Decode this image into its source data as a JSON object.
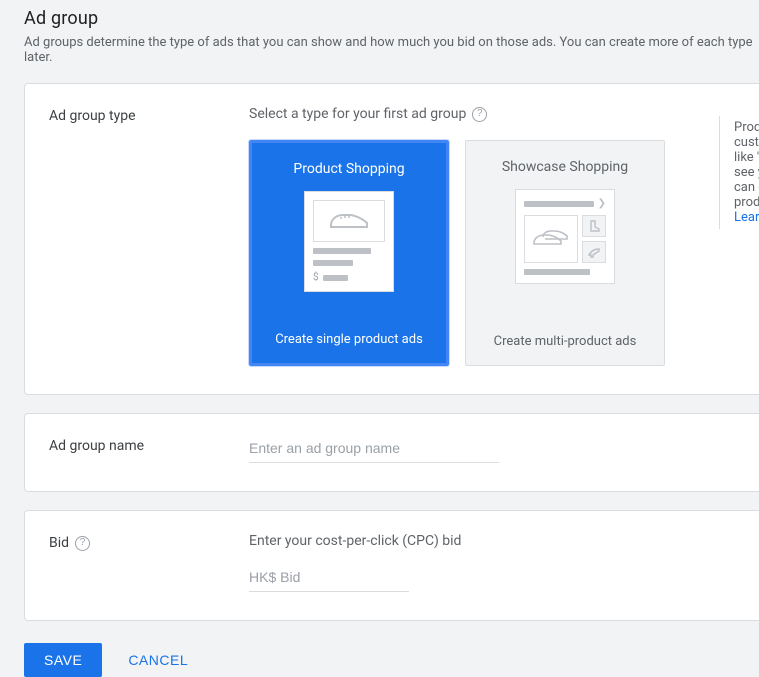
{
  "header": {
    "title": "Ad group",
    "description": "Ad groups determine the type of ads that you can show and how much you bid on those ads. You can create more of each type later."
  },
  "type_section": {
    "label": "Ad group type",
    "subtitle": "Select a type for your first ad group",
    "cards": [
      {
        "title": "Product Shopping",
        "subtitle": "Create single product ads",
        "selected": true
      },
      {
        "title": "Showcase Shopping",
        "subtitle": "Create multi-product ads",
        "selected": false
      }
    ],
    "side_info": {
      "lines": [
        "Produ",
        "custo",
        "like 'w",
        "see yo",
        "can cl",
        "produ"
      ],
      "link": "Learn"
    }
  },
  "name_section": {
    "label": "Ad group name",
    "placeholder": "Enter an ad group name"
  },
  "bid_section": {
    "label": "Bid",
    "description": "Enter your cost-per-click (CPC) bid",
    "prefix_placeholder": "HK$ Bid"
  },
  "actions": {
    "save": "SAVE",
    "cancel": "CANCEL"
  }
}
